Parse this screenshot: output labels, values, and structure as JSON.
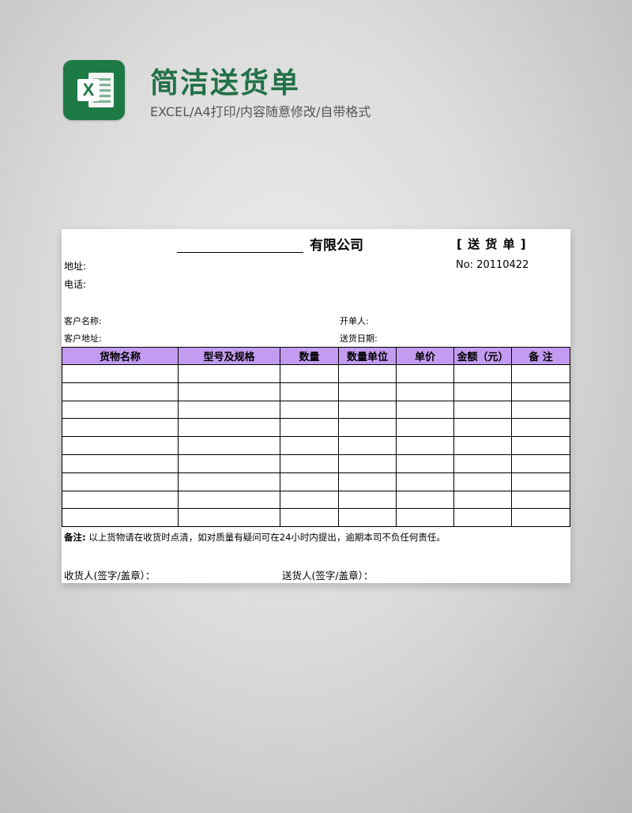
{
  "header": {
    "app_icon": "excel-icon",
    "app_icon_letter": "X",
    "title": "简洁送货单",
    "subtitle": "EXCEL/A4打印/内容随意修改/自带格式",
    "title_color": "#227147"
  },
  "form": {
    "company_suffix": "有限公司",
    "form_type": "[ 送 货 单 ]",
    "address_label": "地址:",
    "phone_label": "电话:",
    "number_text": "No:  20110422",
    "customer_name_label": "客户名称:",
    "customer_address_label": "客户地址:",
    "issuer_label": "开单人:",
    "delivery_date_label": "送货日期:",
    "header_color": "#c39cf1"
  },
  "table": {
    "columns": [
      "货物名称",
      "型号及规格",
      "数量",
      "数量单位",
      "单价",
      "金额（元）",
      "备 注"
    ],
    "empty_row_count": 9
  },
  "footer": {
    "remark_label": "备注:",
    "remark_text": "以上货物请在收货时点清，如对质量有疑问可在24小时内提出，逾期本司不负任何责任。",
    "receiver_label": "收货人(签字/盖章）：",
    "sender_label": "送货人(签字/盖章）："
  }
}
